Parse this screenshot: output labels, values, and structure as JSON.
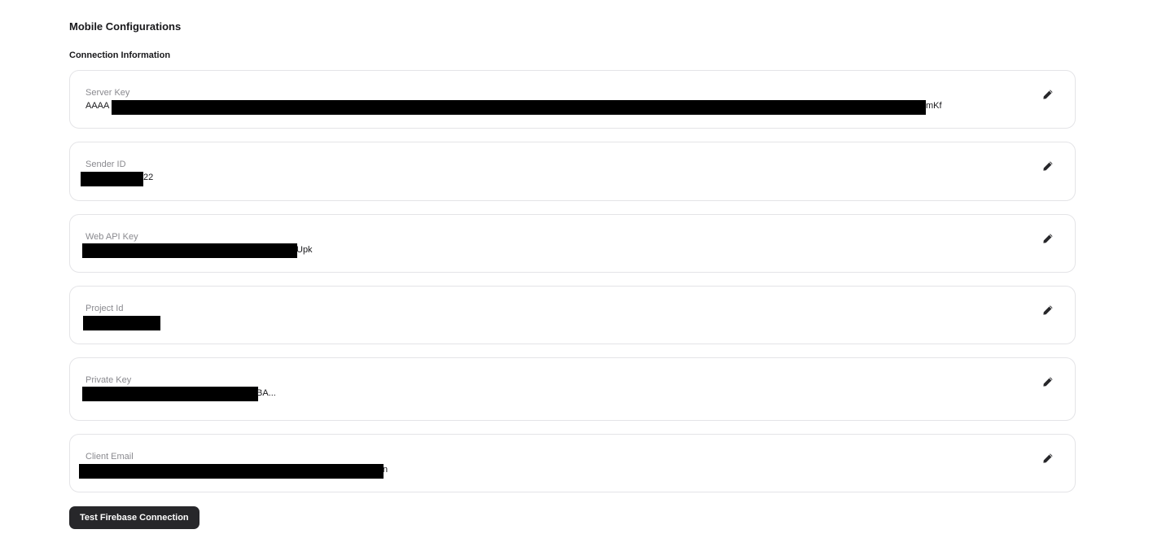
{
  "page": {
    "title": "Mobile Configurations",
    "section_title": "Connection Information"
  },
  "fields": [
    {
      "label": "Server Key",
      "value": "AAAA",
      "value_suffix": "mKf"
    },
    {
      "label": "Sender ID",
      "value": "",
      "value_suffix": "22"
    },
    {
      "label": "Web API Key",
      "value": "",
      "value_suffix": "Upk"
    },
    {
      "label": "Project Id",
      "value": "",
      "value_suffix": ""
    },
    {
      "label": "Private Key",
      "value": "",
      "value_suffix": "BA..."
    },
    {
      "label": "Client Email",
      "value": "",
      "value_suffix": "n"
    }
  ],
  "icons": {
    "edit": "pencil-icon"
  },
  "actions": {
    "test_connection_label": "Test Firebase Connection"
  },
  "colors": {
    "button_bg": "#27272a",
    "card_border": "#e4e4e7",
    "label_gray": "#8a8a8f"
  }
}
